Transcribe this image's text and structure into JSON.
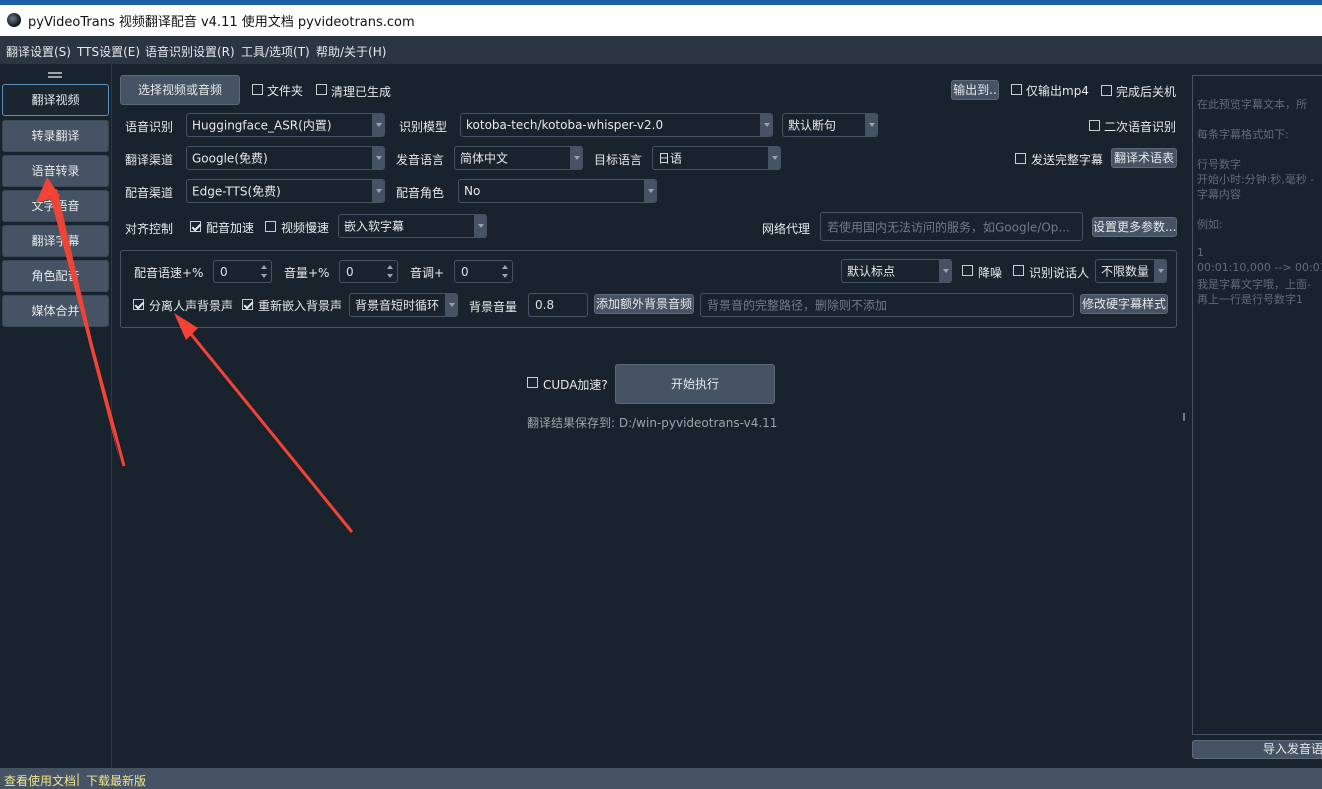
{
  "window": {
    "title": "pyVideoTrans 视频翻译配音 v4.11 使用文档 pyvideotrans.com"
  },
  "menu": [
    "翻译设置(S)",
    "TTS设置(E)",
    "语音识别设置(R)",
    "工具/选项(T)",
    "帮助/关于(H)"
  ],
  "sidebar": {
    "items": [
      {
        "label": "翻译视频"
      },
      {
        "label": "转录翻译"
      },
      {
        "label": "语音转录"
      },
      {
        "label": "文字语音"
      },
      {
        "label": "翻译字幕"
      },
      {
        "label": "角色配音"
      },
      {
        "label": "媒体合并"
      }
    ]
  },
  "top": {
    "select_btn": "选择视频或音频",
    "folder": "文件夹",
    "clear": "清理已生成",
    "output_btn": "输出到..",
    "only_mp4": "仅输出mp4",
    "shutdown": "完成后关机"
  },
  "asr": {
    "label": "语音识别",
    "value": "Huggingface_ASR(内置)",
    "model_label": "识别模型",
    "model_value": "kotoba-tech/kotoba-whisper-v2.0",
    "split_value": "默认断句",
    "second_asr": "二次语音识别"
  },
  "translate": {
    "label": "翻译渠道",
    "value": "Google(免费)",
    "src_label": "发音语言",
    "src_value": "简体中文",
    "tgt_label": "目标语言",
    "tgt_value": "日语",
    "send_full": "发送完整字幕",
    "glossary_btn": "翻译术语表"
  },
  "dubbing": {
    "label": "配音渠道",
    "value": "Edge-TTS(免费)",
    "role_label": "配音角色",
    "role_value": "No"
  },
  "align": {
    "label": "对齐控制",
    "speedup": "配音加速",
    "slowdown": "视频慢速",
    "subtitle_value": "嵌入软字幕",
    "proxy_label": "网络代理",
    "proxy_placeholder": "若使用国内无法访问的服务，如Google/Op...",
    "more_btn": "设置更多参数..."
  },
  "params": {
    "rate_label": "配音语速+%",
    "rate_value": "0",
    "volume_label": "音量+%",
    "volume_value": "0",
    "pitch_label": "音调+",
    "pitch_value": "0",
    "punct_value": "默认标点",
    "denoise": "降噪",
    "speaker": "识别说话人",
    "count_value": "不限数量",
    "separate": "分离人声背景声",
    "reembed": "重新嵌入背景声",
    "loop_value": "背景音短时循环",
    "bgvol_label": "背景音量",
    "bgvol_value": "0.8",
    "add_bg_btn": "添加额外背景音频",
    "bg_path_placeholder": "背景音的完整路径，删除则不添加",
    "hardsub_btn": "修改硬字幕样式"
  },
  "run": {
    "cuda": "CUDA加速?",
    "start_btn": "开始执行",
    "save_path": "翻译结果保存到: D:/win-pyvideotrans-v4.11"
  },
  "preview": {
    "lines": [
      " 在此预览字幕文本，所",
      "",
      "每条字幕格式如下:",
      "",
      "行号数字",
      "开始小时:分钟:秒,毫秒 -",
      "字幕内容",
      "",
      "例如:",
      "",
      "1",
      "00:01:10,000 --> 00:01",
      "我是字幕文字哦，上面-",
      "再上一行是行号数字1"
    ],
    "import_btn": "导入发音语"
  },
  "status": {
    "doc_link": "查看使用文档",
    "sep": " | ",
    "download_link": "下载最新版"
  },
  "colors": {
    "accent": "#f44336",
    "status_link": "#f0e68c"
  }
}
